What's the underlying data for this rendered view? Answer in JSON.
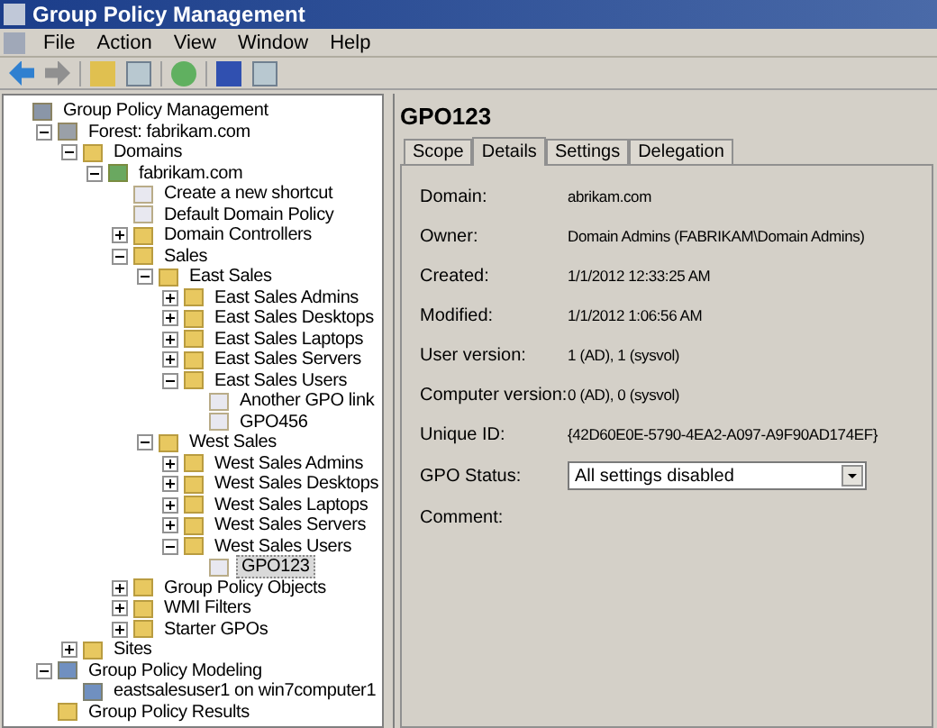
{
  "window": {
    "title": "Group Policy Management"
  },
  "menu": [
    "File",
    "Action",
    "View",
    "Window",
    "Help"
  ],
  "tree": [
    {
      "label": "Group Policy Management",
      "kind": "root",
      "selected": false,
      "children": [
        {
          "label": "Forest: fabrikam.com",
          "kind": "forest",
          "expanded": true,
          "selected": false,
          "children": [
            {
              "label": "Domains",
              "kind": "domains",
              "expanded": true,
              "selected": false,
              "children": [
                {
                  "label": "fabrikam.com",
                  "kind": "domain",
                  "expanded": true,
                  "selected": false,
                  "children": [
                    {
                      "label": "Create a new shortcut",
                      "kind": "link",
                      "selected": false
                    },
                    {
                      "label": "Default Domain Policy",
                      "kind": "link",
                      "selected": false
                    },
                    {
                      "label": "Domain Controllers",
                      "kind": "ou",
                      "expanded": false,
                      "selected": false
                    },
                    {
                      "label": "Sales",
                      "kind": "ou",
                      "expanded": true,
                      "selected": false,
                      "children": [
                        {
                          "label": "East Sales",
                          "kind": "ou",
                          "expanded": true,
                          "selected": false,
                          "children": [
                            {
                              "label": "East Sales Admins",
                              "kind": "ou",
                              "expanded": false,
                              "selected": false
                            },
                            {
                              "label": "East Sales Desktops",
                              "kind": "ou",
                              "expanded": false,
                              "selected": false
                            },
                            {
                              "label": "East Sales Laptops",
                              "kind": "ou",
                              "expanded": false,
                              "selected": false
                            },
                            {
                              "label": "East Sales Servers",
                              "kind": "ou",
                              "expanded": false,
                              "selected": false
                            },
                            {
                              "label": "East Sales Users",
                              "kind": "ou",
                              "expanded": true,
                              "selected": false,
                              "children": [
                                {
                                  "label": "Another GPO link",
                                  "kind": "link",
                                  "selected": false
                                },
                                {
                                  "label": "GPO456",
                                  "kind": "link",
                                  "selected": false
                                }
                              ]
                            }
                          ]
                        },
                        {
                          "label": "West Sales",
                          "kind": "ou",
                          "expanded": true,
                          "selected": false,
                          "children": [
                            {
                              "label": "West Sales Admins",
                              "kind": "ou",
                              "expanded": false,
                              "selected": false
                            },
                            {
                              "label": "West Sales Desktops",
                              "kind": "ou",
                              "expanded": false,
                              "selected": false
                            },
                            {
                              "label": "West Sales Laptops",
                              "kind": "ou",
                              "expanded": false,
                              "selected": false
                            },
                            {
                              "label": "West Sales Servers",
                              "kind": "ou",
                              "expanded": false,
                              "selected": false
                            },
                            {
                              "label": "West Sales Users",
                              "kind": "ou",
                              "expanded": true,
                              "selected": false,
                              "children": [
                                {
                                  "label": "GPO123",
                                  "kind": "link",
                                  "selected": true
                                }
                              ]
                            }
                          ]
                        }
                      ]
                    },
                    {
                      "label": "Group Policy Objects",
                      "kind": "gpos",
                      "expanded": false,
                      "selected": false
                    },
                    {
                      "label": "WMI Filters",
                      "kind": "wmi",
                      "expanded": false,
                      "selected": false
                    },
                    {
                      "label": "Starter GPOs",
                      "kind": "starter",
                      "expanded": false,
                      "selected": false
                    }
                  ]
                }
              ]
            },
            {
              "label": "Sites",
              "kind": "sites",
              "expanded": false,
              "selected": false
            }
          ]
        },
        {
          "label": "Group Policy Modeling",
          "kind": "modeling",
          "expanded": true,
          "selected": false,
          "children": [
            {
              "label": "eastsalesuser1 on win7computer1",
              "kind": "modeling",
              "selected": false
            }
          ]
        },
        {
          "label": "Group Policy Results",
          "kind": "results",
          "selected": false
        }
      ]
    }
  ],
  "detail": {
    "title": "GPO123",
    "tabs": [
      {
        "label": "Scope",
        "selected": false
      },
      {
        "label": "Details",
        "selected": true
      },
      {
        "label": "Settings",
        "selected": false
      },
      {
        "label": "Delegation",
        "selected": false
      }
    ],
    "fields": [
      {
        "label": "Domain:",
        "value": "abrikam.com"
      },
      {
        "label": "Owner:",
        "value": "Domain Admins (FABRIKAM\\Domain Admins)"
      },
      {
        "label": "Created:",
        "value": "1/1/2012 12:33:25 AM"
      },
      {
        "label": "Modified:",
        "value": "1/1/2012 1:06:56 AM"
      },
      {
        "label": "User version:",
        "value": "1 (AD), 1 (sysvol)"
      },
      {
        "label": "Computer version:",
        "value": "0 (AD), 0 (sysvol)"
      },
      {
        "label": "Unique ID:",
        "value": "{42D60E0E-5790-4EA2-A097-A9F90AD174EF}"
      }
    ],
    "gpo_status": {
      "label": "GPO Status:",
      "value": "All settings disabled"
    },
    "comment": {
      "label": "Comment:"
    }
  }
}
